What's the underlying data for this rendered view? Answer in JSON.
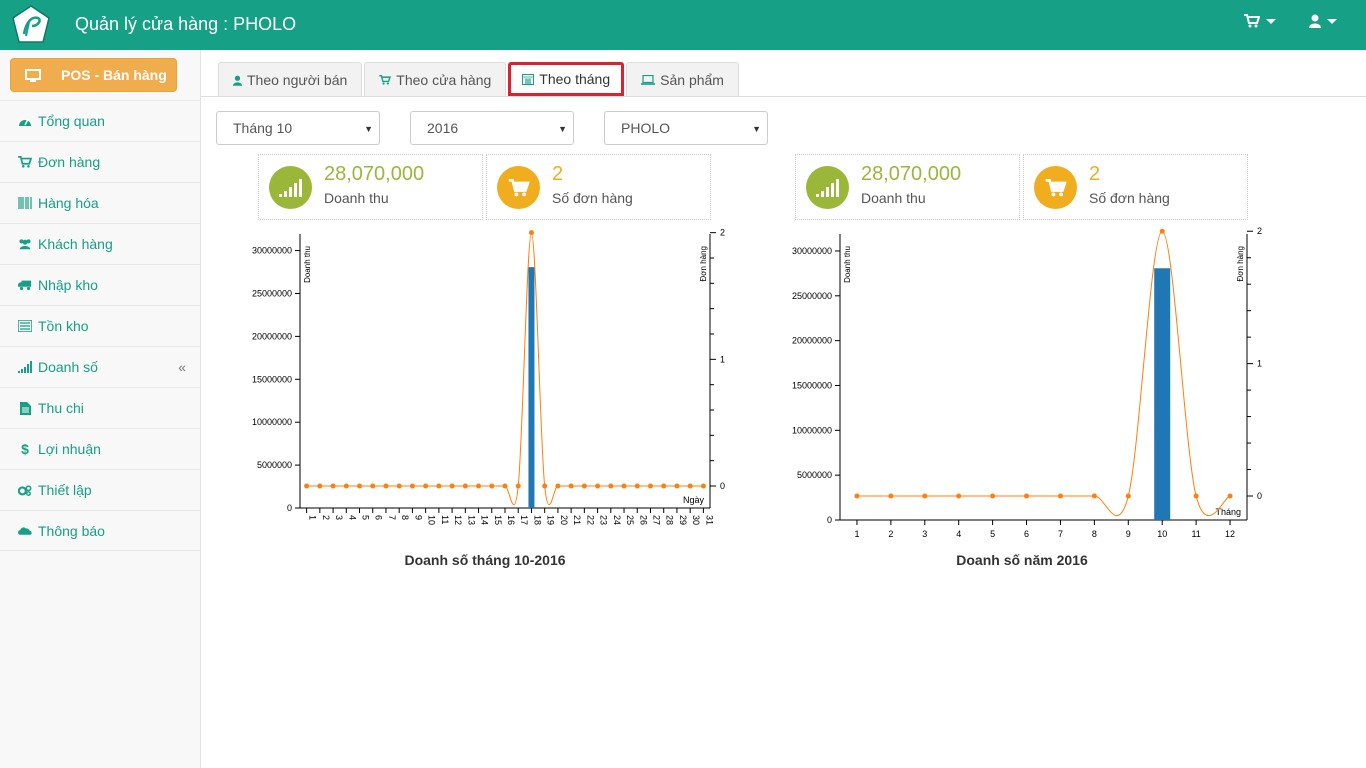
{
  "header": {
    "title": "Quản lý cửa hàng : PHOLO",
    "colors": {
      "bar": "#16a085"
    }
  },
  "sidebar": {
    "pos_label": "POS - Bán hàng",
    "items": [
      {
        "label": "Tổng quan",
        "icon": "dashboard-icon"
      },
      {
        "label": "Đơn hàng",
        "icon": "cart-icon"
      },
      {
        "label": "Hàng hóa",
        "icon": "barcode-icon"
      },
      {
        "label": "Khách hàng",
        "icon": "users-icon"
      },
      {
        "label": "Nhập kho",
        "icon": "truck-icon"
      },
      {
        "label": "Tồn kho",
        "icon": "list-icon"
      },
      {
        "label": "Doanh số",
        "icon": "signal-icon"
      },
      {
        "label": "Thu chi",
        "icon": "file-icon"
      },
      {
        "label": "Lợi nhuận",
        "icon": "dollar-icon"
      },
      {
        "label": "Thiết lập",
        "icon": "cogs-icon"
      },
      {
        "label": "Thông báo",
        "icon": "cloud-icon"
      }
    ],
    "collapse_glyph": "«"
  },
  "tabs": [
    {
      "label": "Theo người bán",
      "icon": "user-icon"
    },
    {
      "label": "Theo cửa hàng",
      "icon": "cart-icon"
    },
    {
      "label": "Theo tháng",
      "icon": "calendar-icon",
      "active": true
    },
    {
      "label": "Sản phẩm",
      "icon": "laptop-icon"
    }
  ],
  "filters": {
    "month": "Tháng 10",
    "year": "2016",
    "store": "PHOLO"
  },
  "stats": [
    {
      "value": "28,070,000",
      "label": "Doanh thu",
      "icon": "signal-icon"
    },
    {
      "value": "2",
      "label": "Số đơn hàng",
      "icon": "cart-icon"
    },
    {
      "value": "28,070,000",
      "label": "Doanh thu",
      "icon": "signal-icon"
    },
    {
      "value": "2",
      "label": "Số đơn hàng",
      "icon": "cart-icon"
    }
  ],
  "chart_titles": {
    "daily": "Doanh số tháng 10-2016",
    "monthly": "Doanh số năm 2016"
  },
  "chart_data": [
    {
      "type": "bar",
      "title": "Doanh số tháng 10-2016",
      "xlabel": "Ngày",
      "ylabel": "Doanh thu",
      "y2label": "Đơn hàng",
      "categories": [
        "1",
        "2",
        "3",
        "4",
        "5",
        "6",
        "7",
        "8",
        "9",
        "10",
        "11",
        "12",
        "13",
        "14",
        "15",
        "16",
        "17",
        "18",
        "19",
        "20",
        "21",
        "22",
        "23",
        "24",
        "25",
        "26",
        "27",
        "28",
        "29",
        "30",
        "31"
      ],
      "series": [
        {
          "name": "Doanh thu",
          "type": "bar",
          "values": [
            0,
            0,
            0,
            0,
            0,
            0,
            0,
            0,
            0,
            0,
            0,
            0,
            0,
            0,
            0,
            0,
            0,
            28070000,
            0,
            0,
            0,
            0,
            0,
            0,
            0,
            0,
            0,
            0,
            0,
            0,
            0
          ]
        },
        {
          "name": "Đơn hàng",
          "type": "line",
          "axis": "right",
          "values": [
            0,
            0,
            0,
            0,
            0,
            0,
            0,
            0,
            0,
            0,
            0,
            0,
            0,
            0,
            0,
            0,
            0,
            2,
            0,
            0,
            0,
            0,
            0,
            0,
            0,
            0,
            0,
            0,
            0,
            0,
            0
          ]
        }
      ],
      "yticks": [
        "0",
        "5000000",
        "10000000",
        "15000000",
        "20000000",
        "25000000",
        "30000000"
      ],
      "ylim": [
        0,
        31000000
      ],
      "y2ticks": [
        "0",
        "1",
        "2"
      ],
      "y2lim": [
        0,
        2.1
      ]
    },
    {
      "type": "bar",
      "title": "Doanh số năm 2016",
      "xlabel": "Tháng",
      "ylabel": "Doanh thu",
      "y2label": "Đơn hàng",
      "categories": [
        "1",
        "2",
        "3",
        "4",
        "5",
        "6",
        "7",
        "8",
        "9",
        "10",
        "11",
        "12"
      ],
      "series": [
        {
          "name": "Doanh thu",
          "type": "bar",
          "values": [
            0,
            0,
            0,
            0,
            0,
            0,
            0,
            0,
            0,
            28070000,
            0,
            0
          ]
        },
        {
          "name": "Đơn hàng",
          "type": "line",
          "axis": "right",
          "values": [
            0,
            0,
            0,
            0,
            0,
            0,
            0,
            0,
            0,
            2,
            0,
            0
          ]
        }
      ],
      "yticks": [
        "0",
        "5000000",
        "10000000",
        "15000000",
        "20000000",
        "25000000",
        "30000000"
      ],
      "ylim": [
        0,
        31000000
      ],
      "y2ticks": [
        "0",
        "1",
        "2"
      ],
      "y2lim": [
        0,
        2.1
      ],
      "colors": {
        "bar": "#1f77b4",
        "line": "#ff7f0e"
      }
    }
  ]
}
